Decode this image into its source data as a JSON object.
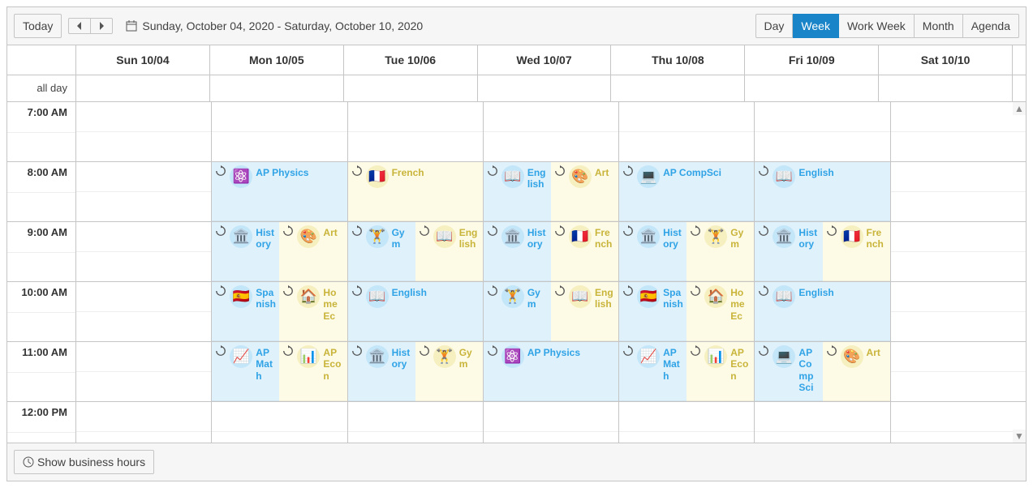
{
  "toolbar": {
    "today": "Today",
    "prev": "◀",
    "next": "▶",
    "date_range": "Sunday, October 04, 2020 - Saturday, October 10, 2020",
    "views": [
      "Day",
      "Week",
      "Work Week",
      "Month",
      "Agenda"
    ],
    "selected_view": "Week"
  },
  "allday_label": "all day",
  "day_headers": [
    "Sun 10/04",
    "Mon 10/05",
    "Tue 10/06",
    "Wed 10/07",
    "Thu 10/08",
    "Fri 10/09",
    "Sat 10/10"
  ],
  "hours": [
    "7:00 AM",
    "8:00 AM",
    "9:00 AM",
    "10:00 AM",
    "11:00 AM",
    "12:00 PM"
  ],
  "footer": {
    "business_hours": "Show business hours"
  },
  "colors": {
    "sci_bg": "#dff1fb",
    "sci_text": "#2fa3e6",
    "arts_bg": "#fdfbe6",
    "arts_text": "#c9b43a",
    "primary": "#1984c8"
  },
  "events": [
    {
      "day": 1,
      "slot": 1,
      "span": 2,
      "col": "full",
      "cat": "sci",
      "icon": "⚛️",
      "title": "AP Physics"
    },
    {
      "day": 1,
      "slot": 2,
      "span": 2,
      "col": "left",
      "cat": "sci",
      "icon": "🏛️",
      "title": "History"
    },
    {
      "day": 1,
      "slot": 2,
      "span": 2,
      "col": "right",
      "cat": "arts",
      "icon": "🎨",
      "title": "Art"
    },
    {
      "day": 1,
      "slot": 3,
      "span": 2,
      "col": "left",
      "cat": "sci",
      "icon": "🇪🇸",
      "title": "Spanish"
    },
    {
      "day": 1,
      "slot": 3,
      "span": 2,
      "col": "right",
      "cat": "arts",
      "icon": "🏠",
      "title": "Home Ec"
    },
    {
      "day": 1,
      "slot": 4,
      "span": 2,
      "col": "left",
      "cat": "sci",
      "icon": "📈",
      "title": "AP Math"
    },
    {
      "day": 1,
      "slot": 4,
      "span": 2,
      "col": "right",
      "cat": "arts",
      "icon": "📊",
      "title": "AP Econ"
    },
    {
      "day": 2,
      "slot": 1,
      "span": 2,
      "col": "full",
      "cat": "arts",
      "icon": "🇫🇷",
      "title": "French"
    },
    {
      "day": 2,
      "slot": 2,
      "span": 2,
      "col": "left",
      "cat": "sci",
      "icon": "🏋️",
      "title": "Gym"
    },
    {
      "day": 2,
      "slot": 2,
      "span": 2,
      "col": "right",
      "cat": "arts",
      "icon": "📖",
      "title": "English"
    },
    {
      "day": 2,
      "slot": 3,
      "span": 2,
      "col": "full",
      "cat": "sci",
      "icon": "📖",
      "title": "English"
    },
    {
      "day": 2,
      "slot": 4,
      "span": 2,
      "col": "left",
      "cat": "sci",
      "icon": "🏛️",
      "title": "History"
    },
    {
      "day": 2,
      "slot": 4,
      "span": 2,
      "col": "right",
      "cat": "arts",
      "icon": "🏋️",
      "title": "Gym"
    },
    {
      "day": 3,
      "slot": 1,
      "span": 2,
      "col": "left",
      "cat": "sci",
      "icon": "📖",
      "title": "English"
    },
    {
      "day": 3,
      "slot": 1,
      "span": 2,
      "col": "right",
      "cat": "arts",
      "icon": "🎨",
      "title": "Art"
    },
    {
      "day": 3,
      "slot": 2,
      "span": 2,
      "col": "left",
      "cat": "sci",
      "icon": "🏛️",
      "title": "History"
    },
    {
      "day": 3,
      "slot": 2,
      "span": 2,
      "col": "right",
      "cat": "arts",
      "icon": "🇫🇷",
      "title": "French"
    },
    {
      "day": 3,
      "slot": 3,
      "span": 2,
      "col": "left",
      "cat": "sci",
      "icon": "🏋️",
      "title": "Gym"
    },
    {
      "day": 3,
      "slot": 3,
      "span": 2,
      "col": "right",
      "cat": "arts",
      "icon": "📖",
      "title": "English"
    },
    {
      "day": 3,
      "slot": 4,
      "span": 2,
      "col": "full",
      "cat": "sci",
      "icon": "⚛️",
      "title": "AP Physics"
    },
    {
      "day": 4,
      "slot": 1,
      "span": 2,
      "col": "full",
      "cat": "sci",
      "icon": "💻",
      "title": "AP CompSci"
    },
    {
      "day": 4,
      "slot": 2,
      "span": 2,
      "col": "left",
      "cat": "sci",
      "icon": "🏛️",
      "title": "History"
    },
    {
      "day": 4,
      "slot": 2,
      "span": 2,
      "col": "right",
      "cat": "arts",
      "icon": "🏋️",
      "title": "Gym"
    },
    {
      "day": 4,
      "slot": 3,
      "span": 2,
      "col": "left",
      "cat": "sci",
      "icon": "🇪🇸",
      "title": "Spanish"
    },
    {
      "day": 4,
      "slot": 3,
      "span": 2,
      "col": "right",
      "cat": "arts",
      "icon": "🏠",
      "title": "Home Ec"
    },
    {
      "day": 4,
      "slot": 4,
      "span": 2,
      "col": "left",
      "cat": "sci",
      "icon": "📈",
      "title": "AP Math"
    },
    {
      "day": 4,
      "slot": 4,
      "span": 2,
      "col": "right",
      "cat": "arts",
      "icon": "📊",
      "title": "AP Econ"
    },
    {
      "day": 5,
      "slot": 1,
      "span": 2,
      "col": "full",
      "cat": "sci",
      "icon": "📖",
      "title": "English"
    },
    {
      "day": 5,
      "slot": 2,
      "span": 2,
      "col": "left",
      "cat": "sci",
      "icon": "🏛️",
      "title": "History"
    },
    {
      "day": 5,
      "slot": 2,
      "span": 2,
      "col": "right",
      "cat": "arts",
      "icon": "🇫🇷",
      "title": "French"
    },
    {
      "day": 5,
      "slot": 3,
      "span": 2,
      "col": "full",
      "cat": "sci",
      "icon": "📖",
      "title": "English"
    },
    {
      "day": 5,
      "slot": 4,
      "span": 2,
      "col": "left",
      "cat": "sci",
      "icon": "💻",
      "title": "AP CompSci"
    },
    {
      "day": 5,
      "slot": 4,
      "span": 2,
      "col": "right",
      "cat": "arts",
      "icon": "🎨",
      "title": "Art"
    }
  ]
}
